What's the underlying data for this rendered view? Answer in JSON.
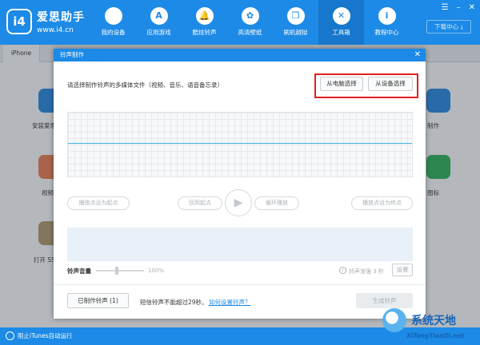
{
  "app": {
    "logo_text": "i4",
    "name": "爱思助手",
    "url": "www.i4.cn",
    "download_label": "下载中心"
  },
  "nav": {
    "items": [
      {
        "label": "我的设备",
        "icon": "apple-icon",
        "glyph": ""
      },
      {
        "label": "应用游戏",
        "icon": "app-store-icon",
        "glyph": "A"
      },
      {
        "label": "酷炫铃声",
        "icon": "bell-icon",
        "glyph": "🔔"
      },
      {
        "label": "高清壁纸",
        "icon": "flower-icon",
        "glyph": "✿"
      },
      {
        "label": "刷机越狱",
        "icon": "box-icon",
        "glyph": "❒"
      },
      {
        "label": "工具箱",
        "icon": "tools-icon",
        "glyph": "✕"
      },
      {
        "label": "教程中心",
        "icon": "info-icon",
        "glyph": "i"
      }
    ],
    "active_index": 5
  },
  "tabs": {
    "device": "iPhone"
  },
  "background": {
    "labels": [
      "安装爱思",
      "视频",
      "打开 SS",
      "制作",
      "图标"
    ]
  },
  "modal": {
    "title": "铃声制作",
    "close_glyph": "✕",
    "prompt": "请选择制作铃声的多媒体文件（视频、音乐、语音备忘录）",
    "from_pc": "从电脑选择",
    "from_device": "从设备选择",
    "controls": {
      "set_start": "播放点设为起点",
      "back_to_start": "回到起点",
      "loop": "循环播放",
      "set_end": "播放点设为终点",
      "play_glyph": "▶"
    },
    "volume": {
      "label": "铃声音量",
      "value": "100%",
      "level": 1.0
    },
    "fade": {
      "label": "铃声渐强 3 秒",
      "check_glyph": "✓",
      "settings": "设置"
    },
    "made_ringtones": "已制作铃声 (1)",
    "limit_note": "短信铃声不能超过29秒。",
    "help_link": "如何设置铃声？",
    "generate": "生成铃声"
  },
  "status": {
    "text": "阻止iTunes自动运行"
  },
  "watermark": {
    "title": "系统天地",
    "url": "XiTongTianDi.net"
  }
}
